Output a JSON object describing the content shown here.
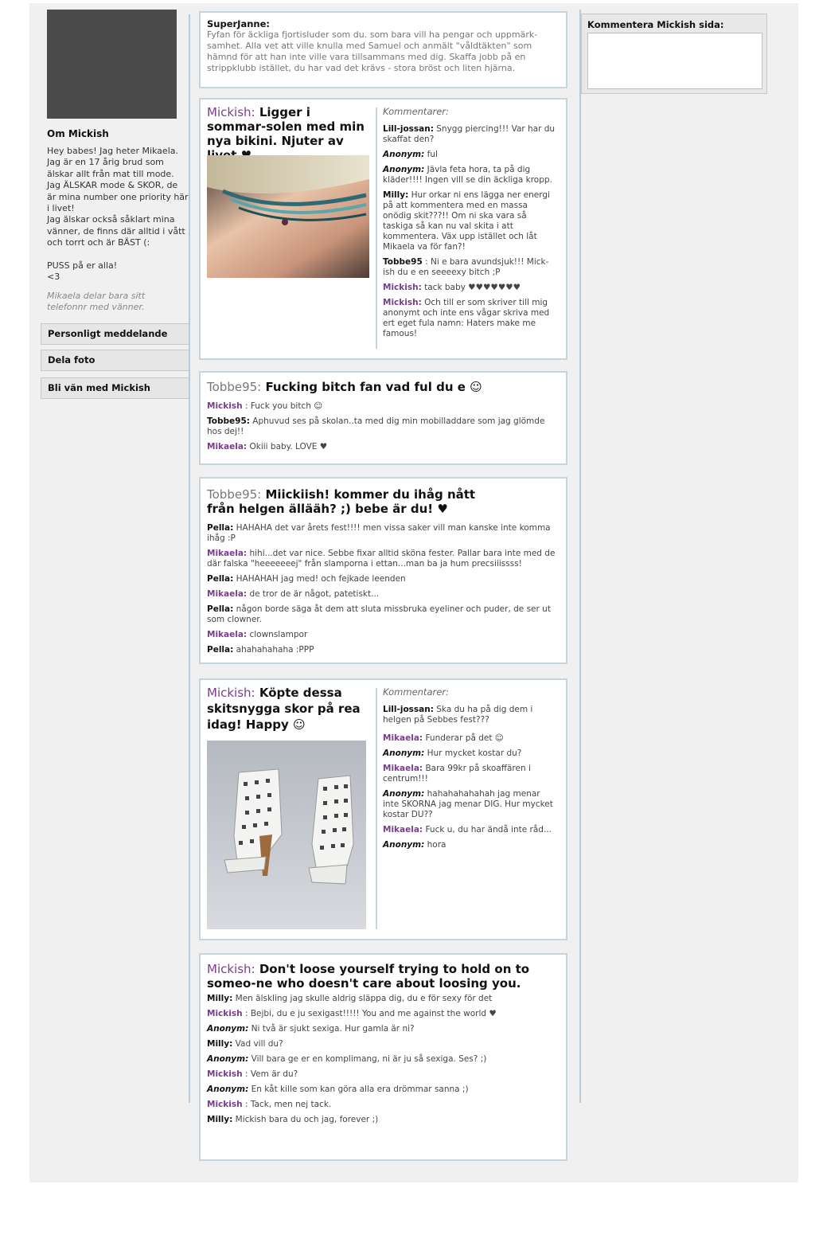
{
  "profile": {
    "about_title": "Om Mickish",
    "about_text": "Hey babes! Jag heter Mikaela. Jag är en 17 årig brud som älskar allt från mat till mode. Jag ÄLSKAR mode & SKOR, de är mina number one priority här i livet!\nJag älskar också såklart mina vänner, de finns där alltid i vått och torrt och är BÄST (:\n\nPUSS på er alla!\n<3",
    "phone_note": "Mikaela delar bara sitt telefonnr med vänner.",
    "buttons": {
      "message": "Personligt meddelande",
      "share_photo": "Dela foto",
      "befriend": "Bli vän med Mickish"
    }
  },
  "comment_box": {
    "label": "Kommentera Mickish sida:",
    "value": ""
  },
  "wall": {
    "top_comment": {
      "author": "SuperJanne:",
      "text": "Fyfan för äckliga fjortisluder som du. som bara vill ha pengar och uppmärk-samhet. Alla vet att ville knulla med Samuel och anmält \"våldtäkten\" som hämnd för att han inte ville vara tillsammans med dig. Skaffa jobb på en strippklubb istället, du har vad det krävs - stora bröst och liten hjärna."
    },
    "post1": {
      "author": "Mickish:",
      "title": "Ligger i sommar-solen med min nya bikini. Njuter av livet ♥",
      "comments_head": "Kommentarer:",
      "comments": [
        {
          "author": "Lill-jossan:",
          "text": "Snygg piercing!!! Var har du skaffat den?"
        },
        {
          "author": "Anonym:",
          "text": "ful"
        },
        {
          "author": "Anonym:",
          "text": "Jävla feta hora, ta på dig kläder!!!! Ingen vill se din äckliga kropp."
        },
        {
          "author": "Milly:",
          "text": "Hur orkar ni ens lägga ner energi på att kommentera med en massa onödig skit???!! Om ni ska vara så taskiga så kan nu val skita i att kommentera. Väx upp istället och låt Mikaela va för fan?!"
        },
        {
          "author": "Tobbe95",
          "text": ": Ni e bara avundsjuk!!! Mick-ish du e en seeeexy bitch ;P"
        },
        {
          "author": "Mickish:",
          "text": "tack baby ♥♥♥♥♥♥♥"
        },
        {
          "author": "Mickish:",
          "text": "Och till er som skriver till mig anonymt och inte ens vågar skriva med ert eget fula namn: Haters make me famous!"
        }
      ]
    },
    "post2": {
      "author": "Tobbe95:",
      "title": "Fucking bitch fan vad ful du e ☺",
      "comments": [
        {
          "author": "Mickish",
          "text": ": Fuck you bitch ☺"
        },
        {
          "author": "Tobbe95:",
          "text": "Aphuvud ses på skolan..ta med dig min mobilladdare som jag glömde hos dej!!"
        },
        {
          "author": "Mikaela:",
          "text": "Okiii baby. LOVE ♥"
        }
      ]
    },
    "post3": {
      "author": "Tobbe95:",
      "title": "Miickiish! kommer du ihåg nått från helgen ällääh? ;) bebe är du!  ♥",
      "comments": [
        {
          "author": "Pella:",
          "text": "HAHAHA det var årets fest!!!! men vissa saker vill man kanske inte komma ihåg :P"
        },
        {
          "author": "Mikaela:",
          "text": "hihi...det var nice. Sebbe fixar alltid sköna fester. Pallar bara inte med de där falska \"heeeeeeej\" från slamporna i ettan...man ba ja hum precsiiissss!"
        },
        {
          "author": "Pella:",
          "text": "HAHAHAH jag med! och fejkade leenden"
        },
        {
          "author": "Mikaela:",
          "text": "de tror de är något, patetiskt..."
        },
        {
          "author": "Pella:",
          "text": "någon borde säga åt dem att sluta missbruka eyeliner och puder, de ser ut som clowner."
        },
        {
          "author": "Mikaela:",
          "text": "clownslampor"
        },
        {
          "author": "Pella:",
          "text": " ahahahahaha :PPP"
        }
      ]
    },
    "post4": {
      "author": "Mickish:",
      "title": "Köpte dessa skitsnygga skor på rea idag! Happy ☺",
      "comments_head": "Kommentarer:",
      "comments": [
        {
          "author": "Lill-jossan:",
          "text": "Ska du ha på dig dem i helgen på Sebbes fest???"
        },
        {
          "author": "Mikaela:",
          "text": "Funderar på det ☺"
        },
        {
          "author": "Anonym:",
          "text": "Hur mycket kostar du?"
        },
        {
          "author": "Mikaela:",
          "text": "Bara 99kr på skoaffären i centrum!!!"
        },
        {
          "author": "Anonym:",
          "text": " hahahahahahah jag menar inte SKORNA jag menar DIG. Hur mycket kostar DU??"
        },
        {
          "author": "Mikaela:",
          "text": "Fuck u, du har ändå inte råd..."
        },
        {
          "author": "Anonym:",
          "text": " hora"
        }
      ]
    },
    "post5": {
      "author": "Mickish:",
      "title": "Don't loose yourself trying to hold on to someo-ne who doesn't care about loosing you.",
      "comments": [
        {
          "author": "Milly:",
          "text": "Men älskling jag skulle aldrig släppa dig, du e för sexy för det"
        },
        {
          "author": "Mickish",
          "text": ": Bejbi, du e ju sexigast!!!!! You and me against the world ♥"
        },
        {
          "author": "Anonym:",
          "text": "Ni två är sjukt sexiga. Hur gamla är ni?"
        },
        {
          "author": "Milly:",
          "text": "Vad vill du?"
        },
        {
          "author": "Anonym:",
          "text": "Vill bara ge er en komplimang, ni är ju så sexiga. Ses? ;)"
        },
        {
          "author": "Mickish",
          "text": ": Vem är du?"
        },
        {
          "author": "Anonym:",
          "text": "En kåt kille som kan göra alla era drömmar sanna ;)"
        },
        {
          "author": "Mickish",
          "text": ": Tack, men nej tack."
        },
        {
          "author": "Milly:",
          "text": " Mickish bara du och jag, forever ;)"
        }
      ]
    }
  }
}
